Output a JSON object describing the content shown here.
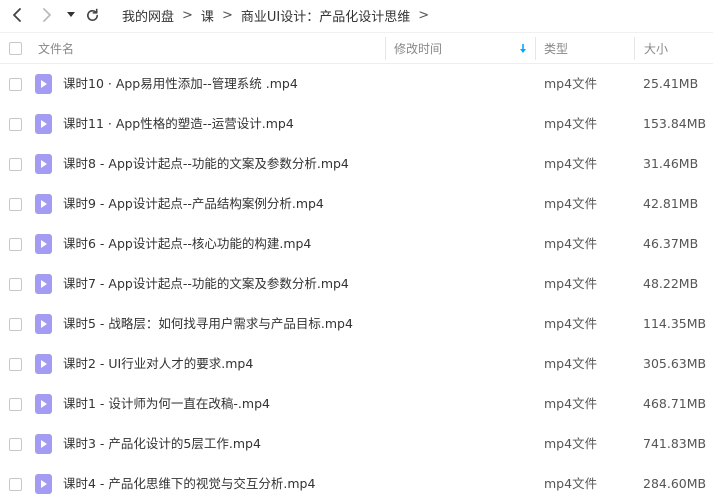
{
  "nav": {
    "back_icon": "chevron-left-icon",
    "forward_icon": "chevron-right-icon",
    "dropdown_icon": "caret-down-icon",
    "refresh_icon": "refresh-icon"
  },
  "breadcrumb": {
    "items": [
      "我的网盘",
      "课",
      "商业UI设计：产品化设计思维"
    ],
    "separator": ">"
  },
  "table": {
    "columns": {
      "name": "文件名",
      "modified": "修改时间",
      "type": "类型",
      "size": "大小"
    },
    "sort_icon": "sort-down-arrow-icon",
    "rows": [
      {
        "name": "课时10 · App易用性添加--管理系统 .mp4",
        "type": "mp4文件",
        "size": "25.41MB"
      },
      {
        "name": "课时11 · App性格的塑造--运营设计.mp4",
        "type": "mp4文件",
        "size": "153.84MB"
      },
      {
        "name": "课时8 - App设计起点--功能的文案及参数分析.mp4",
        "type": "mp4文件",
        "size": "31.46MB"
      },
      {
        "name": "课时9 - App设计起点--产品结构案例分析.mp4",
        "type": "mp4文件",
        "size": "42.81MB"
      },
      {
        "name": "课时6 - App设计起点--核心功能的构建.mp4",
        "type": "mp4文件",
        "size": "46.37MB"
      },
      {
        "name": "课时7 - App设计起点--功能的文案及参数分析.mp4",
        "type": "mp4文件",
        "size": "48.22MB"
      },
      {
        "name": "课时5 - 战略层：如何找寻用户需求与产品目标.mp4",
        "type": "mp4文件",
        "size": "114.35MB"
      },
      {
        "name": "课时2 - UI行业对人才的要求.mp4",
        "type": "mp4文件",
        "size": "305.63MB"
      },
      {
        "name": "课时1 - 设计师为何一直在改稿-.mp4",
        "type": "mp4文件",
        "size": "468.71MB"
      },
      {
        "name": "课时3 - 产品化设计的5层工作.mp4",
        "type": "mp4文件",
        "size": "741.83MB"
      },
      {
        "name": "课时4 - 产品化思维下的视觉与交互分析.mp4",
        "type": "mp4文件",
        "size": "284.60MB"
      }
    ]
  },
  "colors": {
    "file_icon": "#a49bf2",
    "sort_arrow": "#06a7ff"
  }
}
